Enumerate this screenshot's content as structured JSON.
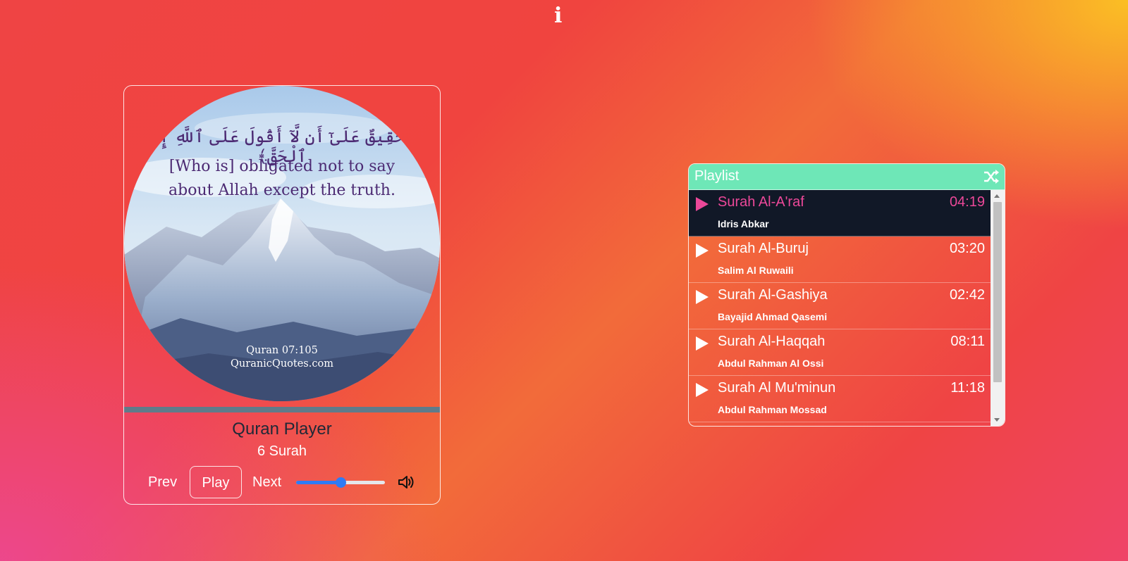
{
  "info_icon": "info-icon",
  "player": {
    "cover": {
      "ayah_arabic": "﴿حَقِيقٌ عَلَىٰٓ أَن لَّآ أَقُولَ عَلَى ٱللَّهِ إِلَّا ٱلْحَقَّ﴾",
      "ayah_line1": "[Who is] obligated not to say",
      "ayah_line2": "about Allah except the truth.",
      "source_ref": "Quran 07:105",
      "source_site": "QuranicQuotes.com"
    },
    "title": "Quran Player",
    "subtitle": "6 Surah",
    "controls": {
      "prev_label": "Prev",
      "play_label": "Play",
      "next_label": "Next",
      "volume": 0.5
    }
  },
  "playlist": {
    "title": "Playlist",
    "items": [
      {
        "name": "Surah Al-A'raf",
        "time": "04:19",
        "artist": "Idris Abkar",
        "active": true
      },
      {
        "name": "Surah Al-Buruj",
        "time": "03:20",
        "artist": "Salim Al Ruwaili",
        "active": false
      },
      {
        "name": "Surah Al-Gashiya",
        "time": "02:42",
        "artist": "Bayajid Ahmad Qasemi",
        "active": false
      },
      {
        "name": "Surah Al-Haqqah",
        "time": "08:11",
        "artist": "Abdul Rahman Al Ossi",
        "active": false
      },
      {
        "name": "Surah Al Mu'minun",
        "time": "11:18",
        "artist": "Abdul Rahman Mossad",
        "active": false
      }
    ]
  },
  "colors": {
    "accent_active": "#ec4899",
    "playlist_header": "#6ee7b7",
    "active_row_bg": "#111827",
    "slider": "#2f7bf5"
  }
}
